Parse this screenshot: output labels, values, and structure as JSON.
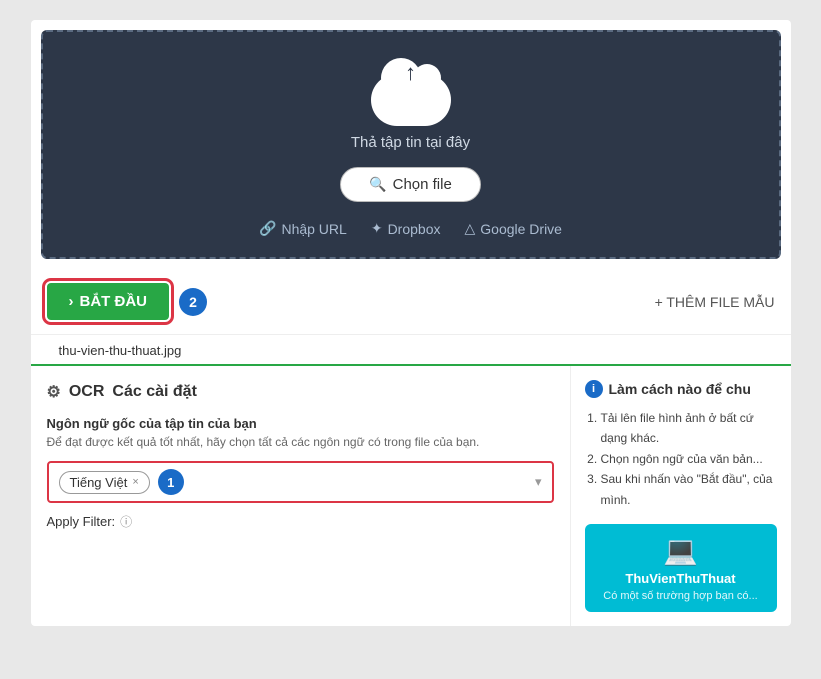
{
  "upload": {
    "drop_text": "Thả tập tin tại đây",
    "choose_file_label": "Chọn file",
    "nhap_url_label": "Nhập URL",
    "dropbox_label": "Dropbox",
    "google_drive_label": "Google Drive"
  },
  "action_bar": {
    "bat_dau_label": "BẮT ĐẦU",
    "bat_dau_arrow": "›",
    "badge_2": "2",
    "them_file_label": "+ THÊM FILE MẪU"
  },
  "file_tab": {
    "filename": "thu-vien-thu-thuat.jpg"
  },
  "settings": {
    "title_ocr": "OCR",
    "title_settings": "Các cài đặt",
    "lang_section_title": "Ngôn ngữ gốc của tập tin của bạn",
    "lang_hint": "Để đạt được kết quả tốt nhất, hãy chọn tất cả các ngôn ngữ có trong file của bạn.",
    "selected_lang": "Tiếng Việt",
    "badge_1": "1",
    "apply_filter_label": "Apply Filter:",
    "dropdown_arrow": "▾"
  },
  "how_to": {
    "title": "Làm cách nào để chu",
    "steps": [
      "Tải lên file hình ảnh ở bất cứ dạng khác.",
      "Chọn ngôn ngữ của văn bản...",
      "Sau khi nhấn vào \"Bắt đầu\", của mình."
    ]
  },
  "promo": {
    "brand": "ThuVienThuThuat",
    "sub": "Có một số trường hợp bạn có..."
  },
  "icons": {
    "cloud": "☁",
    "search": "🔍",
    "link": "🔗",
    "dropbox": "✦",
    "gdrive": "△",
    "gear": "⚙",
    "info": "i",
    "laptop": "💻"
  }
}
